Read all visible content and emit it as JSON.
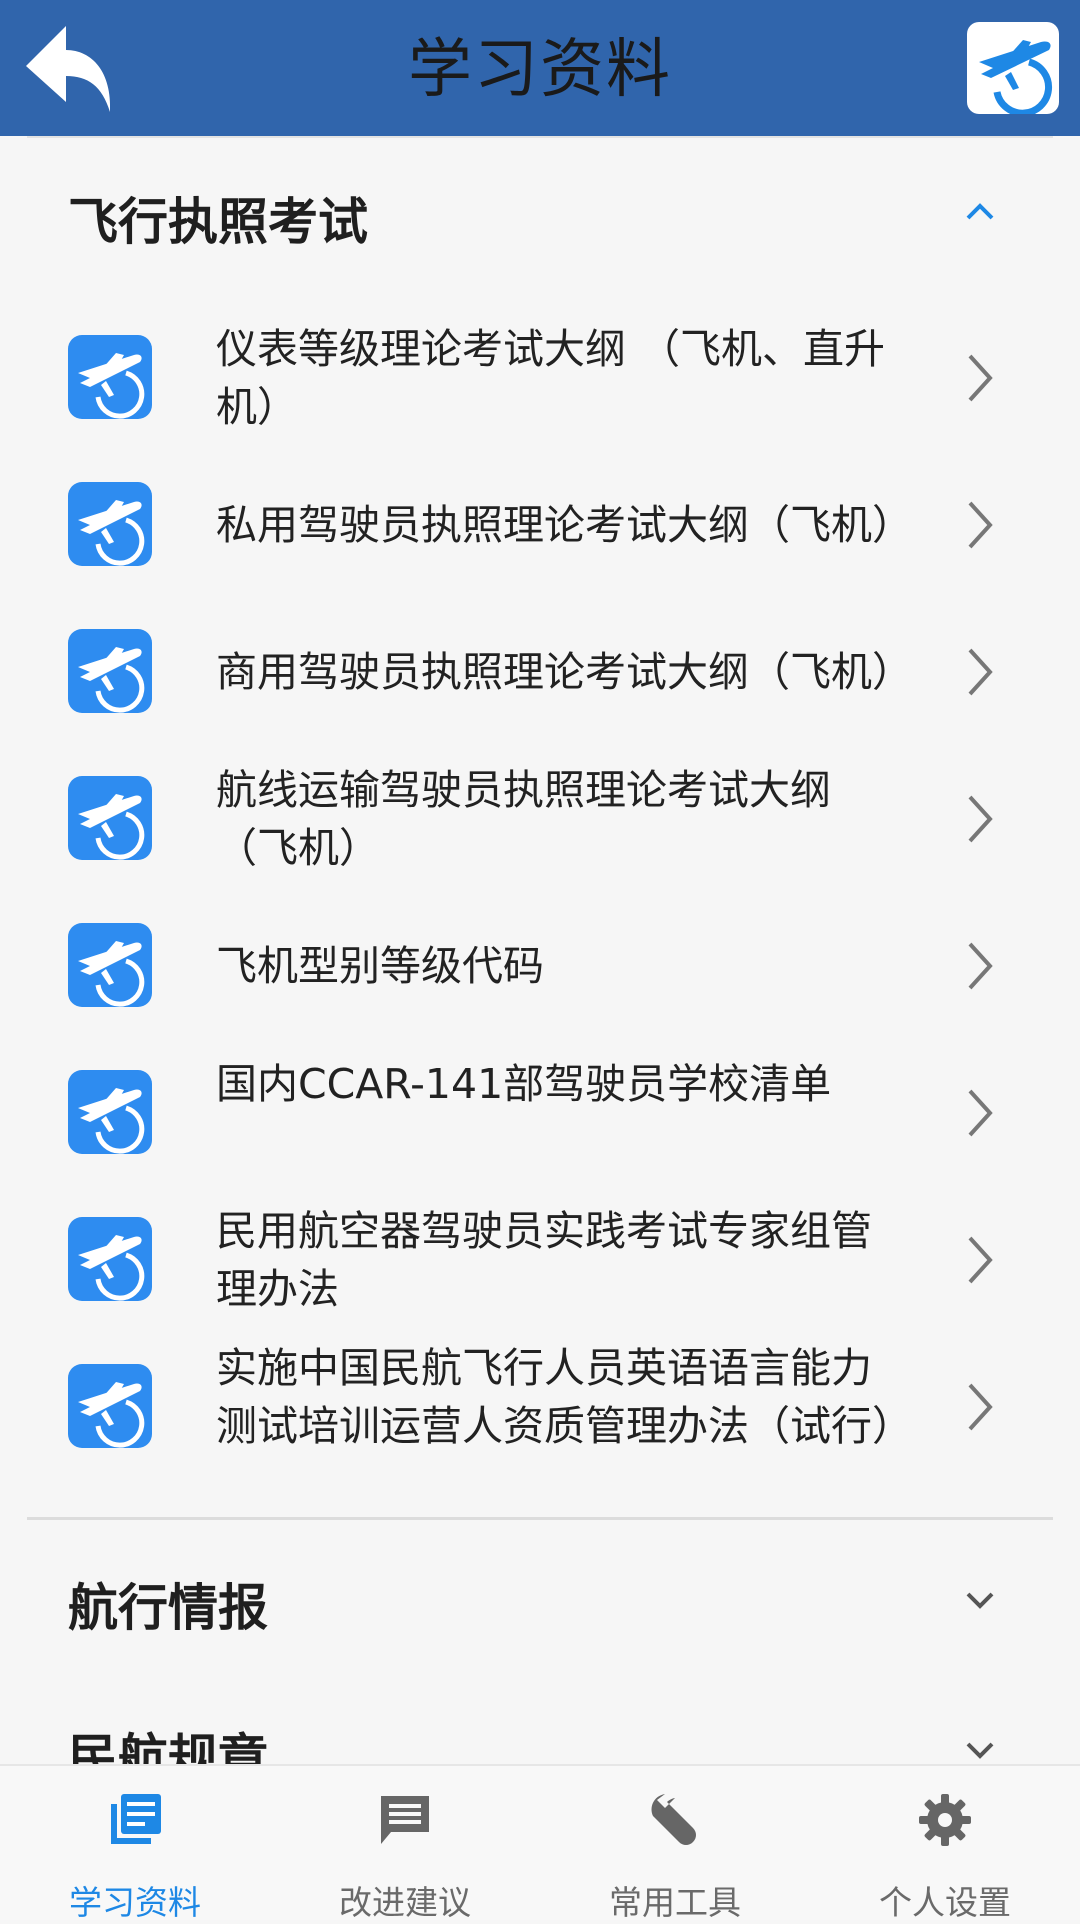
{
  "header": {
    "title": "学习资料",
    "back_icon": "back-arrow-icon",
    "logo_icon": "airplane-logo-icon",
    "color": "#3065ac"
  },
  "sections": [
    {
      "title": "飞行执照考试",
      "expanded": true,
      "items": [
        {
          "label": "仪表等级理论考试大纲 （飞机、直升机）"
        },
        {
          "label": "私用驾驶员执照理论考试大纲（飞机）"
        },
        {
          "label": "商用驾驶员执照理论考试大纲（飞机）"
        },
        {
          "label": "航线运输驾驶员执照理论考试大纲（飞机）"
        },
        {
          "label": "飞机型别等级代码"
        },
        {
          "label": "国内CCAR-141部驾驶员学校清单"
        },
        {
          "label": "民用航空器驾驶员实践考试专家组管理办法"
        },
        {
          "label": "实施中国民航飞行人员英语语言能力测试培训运营人资质管理办法（试行）"
        }
      ]
    },
    {
      "title": "航行情报",
      "expanded": false
    },
    {
      "title": "民航规章",
      "expanded": false
    }
  ],
  "tabbar": {
    "items": [
      {
        "label": "学习资料",
        "icon": "document-icon",
        "active": true
      },
      {
        "label": "改进建议",
        "icon": "chat-icon",
        "active": false
      },
      {
        "label": "常用工具",
        "icon": "wrench-icon",
        "active": false
      },
      {
        "label": "个人设置",
        "icon": "gear-icon",
        "active": false
      }
    ],
    "active_color": "#1e88e5",
    "inactive_color": "#6a6a6a"
  },
  "colors": {
    "accent": "#1e88e5",
    "item_icon_bg": "#2e8cf0"
  }
}
